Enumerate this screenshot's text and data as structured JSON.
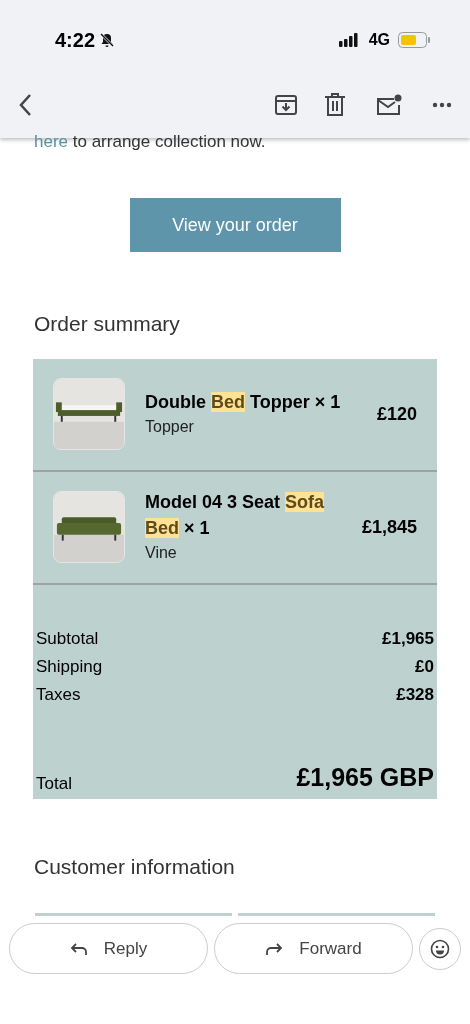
{
  "status_bar": {
    "time": "4:22",
    "network": "4G"
  },
  "email_text": {
    "link": "here",
    "rest": " to arrange collection now."
  },
  "view_order_button": "View your order",
  "order_summary": {
    "title": "Order summary",
    "items": [
      {
        "title": [
          {
            "text": "Double",
            "highlighted": false
          },
          {
            "text": "Bed",
            "highlighted": true
          },
          {
            "text": "Topper × 1",
            "highlighted": false
          }
        ],
        "variant": "Topper",
        "price": "£120",
        "kind": "topper"
      },
      {
        "title": [
          {
            "text": "Model 04 3 Seat",
            "highlighted": false
          },
          {
            "text": "Sofa",
            "highlighted": true
          },
          {
            "text": "Bed",
            "highlighted": true
          },
          {
            "text": "× 1",
            "highlighted": false
          }
        ],
        "variant": "Vine",
        "price": "£1,845",
        "kind": "sofa"
      }
    ],
    "totals": [
      {
        "label": "Subtotal",
        "value": "£1,965"
      },
      {
        "label": "Shipping",
        "value": "£0"
      },
      {
        "label": "Taxes",
        "value": "£328"
      }
    ],
    "total": {
      "label": "Total",
      "value": "£1,965 GBP"
    }
  },
  "customer_information": {
    "title": "Customer information"
  },
  "actions": [
    {
      "label": "Reply",
      "kind": "reply"
    },
    {
      "label": "Forward",
      "kind": "forward"
    }
  ]
}
